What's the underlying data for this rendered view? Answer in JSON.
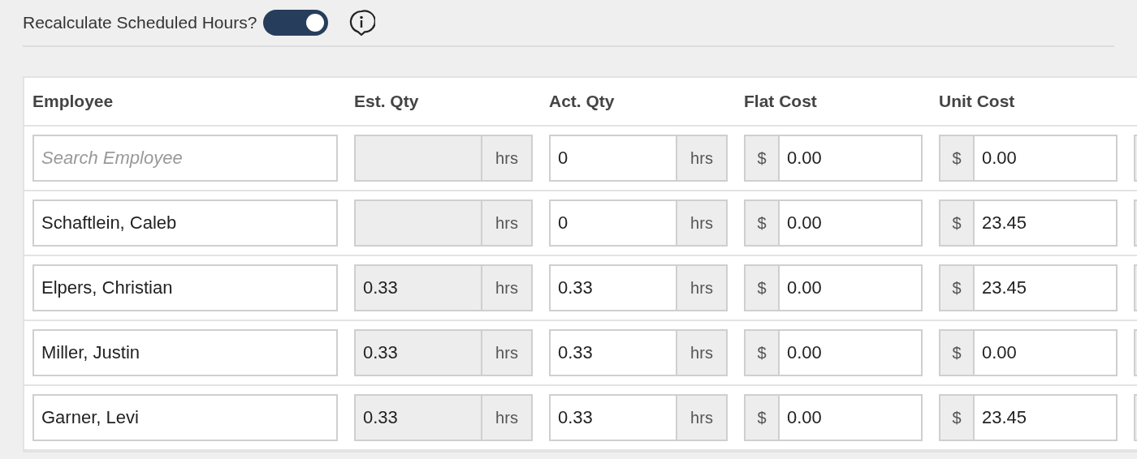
{
  "toggle": {
    "label": "Recalculate Scheduled Hours?",
    "on": true
  },
  "table": {
    "columns": [
      "Employee",
      "Est. Qty",
      "Act. Qty",
      "Flat Cost",
      "Unit Cost"
    ],
    "rows": [
      {
        "employee": {
          "placeholder": "Search Employee"
        },
        "est_qty": {
          "unit": "hrs",
          "disabled": true
        },
        "act_qty": {
          "value": "0",
          "unit": "hrs"
        },
        "flat_cost": {
          "prefix": "$",
          "value": "0.00"
        },
        "unit_cost": {
          "prefix": "$",
          "value": "0.00"
        }
      },
      {
        "employee": {
          "value": "Schaftlein, Caleb"
        },
        "est_qty": {
          "unit": "hrs",
          "disabled": true
        },
        "act_qty": {
          "value": "0",
          "unit": "hrs"
        },
        "flat_cost": {
          "prefix": "$",
          "value": "0.00"
        },
        "unit_cost": {
          "prefix": "$",
          "value": "23.45"
        }
      },
      {
        "employee": {
          "value": "Elpers, Christian"
        },
        "est_qty": {
          "value": "0.33",
          "unit": "hrs",
          "disabled": true
        },
        "act_qty": {
          "value": "0.33",
          "unit": "hrs"
        },
        "flat_cost": {
          "prefix": "$",
          "value": "0.00"
        },
        "unit_cost": {
          "prefix": "$",
          "value": "23.45"
        }
      },
      {
        "employee": {
          "value": "Miller, Justin"
        },
        "est_qty": {
          "value": "0.33",
          "unit": "hrs",
          "disabled": true
        },
        "act_qty": {
          "value": "0.33",
          "unit": "hrs"
        },
        "flat_cost": {
          "prefix": "$",
          "value": "0.00"
        },
        "unit_cost": {
          "prefix": "$",
          "value": "0.00"
        }
      },
      {
        "employee": {
          "value": "Garner, Levi"
        },
        "est_qty": {
          "value": "0.33",
          "unit": "hrs",
          "disabled": true
        },
        "act_qty": {
          "value": "0.33",
          "unit": "hrs"
        },
        "flat_cost": {
          "prefix": "$",
          "value": "0.00"
        },
        "unit_cost": {
          "prefix": "$",
          "value": "23.45"
        }
      }
    ]
  }
}
